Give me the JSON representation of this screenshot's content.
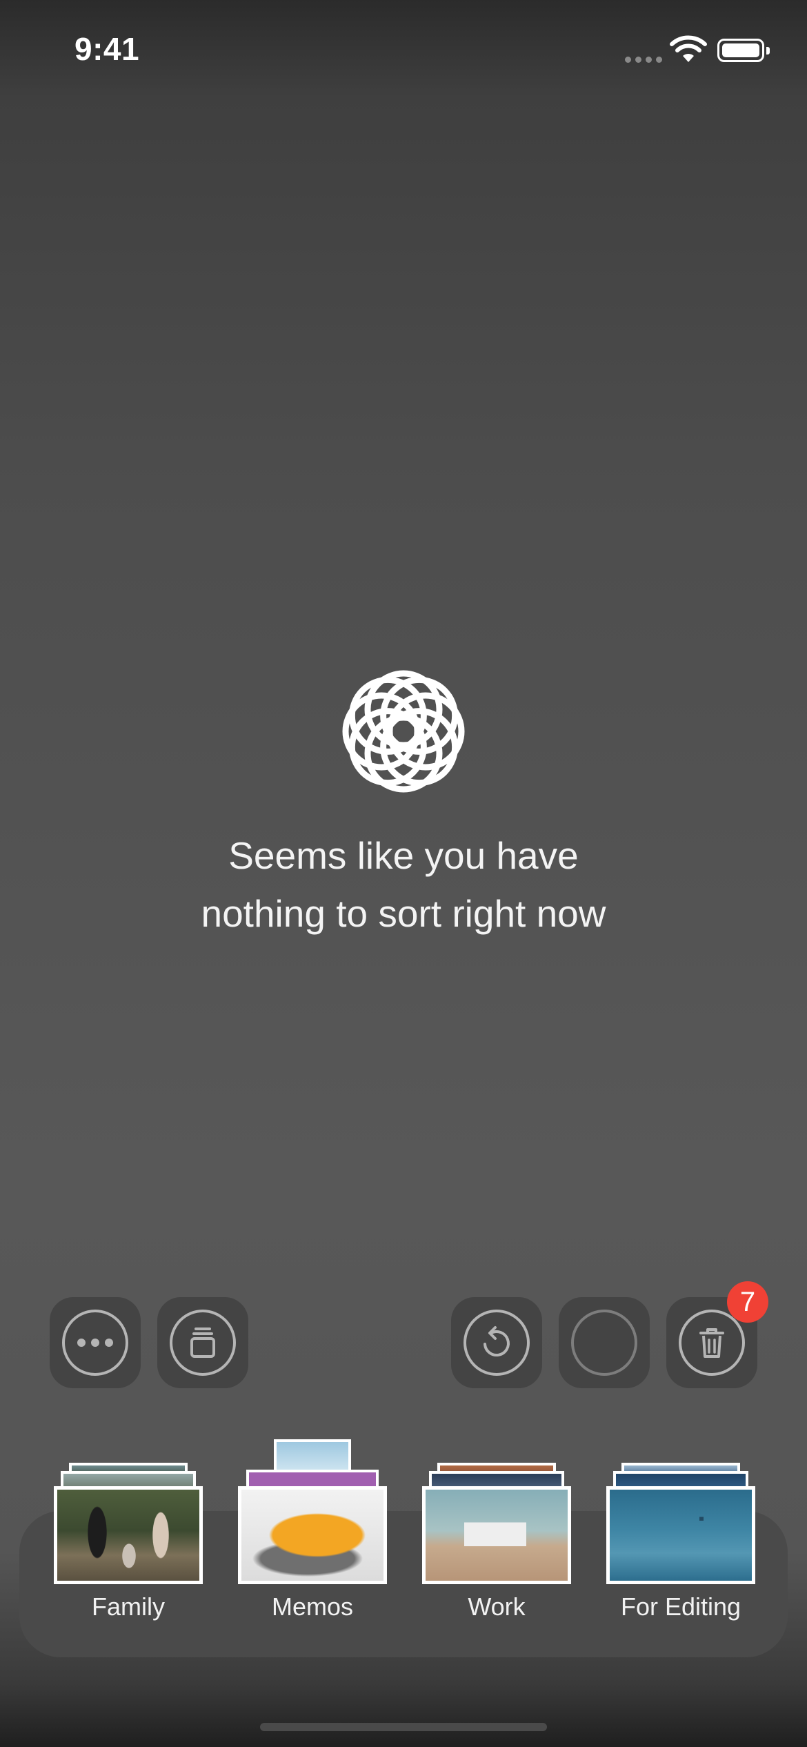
{
  "status_bar": {
    "time": "9:41"
  },
  "empty_state": {
    "line1": "Seems like you have",
    "line2": "nothing to sort right now"
  },
  "controls": {
    "trash_badge": "7"
  },
  "albums": [
    {
      "label": "Family"
    },
    {
      "label": "Memos"
    },
    {
      "label": "Work"
    },
    {
      "label": "For Editing"
    }
  ],
  "icons": {
    "more": "ellipsis-icon",
    "albums": "stack-icon",
    "undo": "undo-icon",
    "empty_circle": "circle-icon",
    "trash": "trash-icon",
    "logo": "flower-logo-icon",
    "wifi": "wifi-icon",
    "battery": "battery-icon",
    "signal": "signal-icon"
  },
  "colors": {
    "badge": "#f04135",
    "button_bg": "#444444",
    "tray_bg": "#4a4a4a"
  }
}
